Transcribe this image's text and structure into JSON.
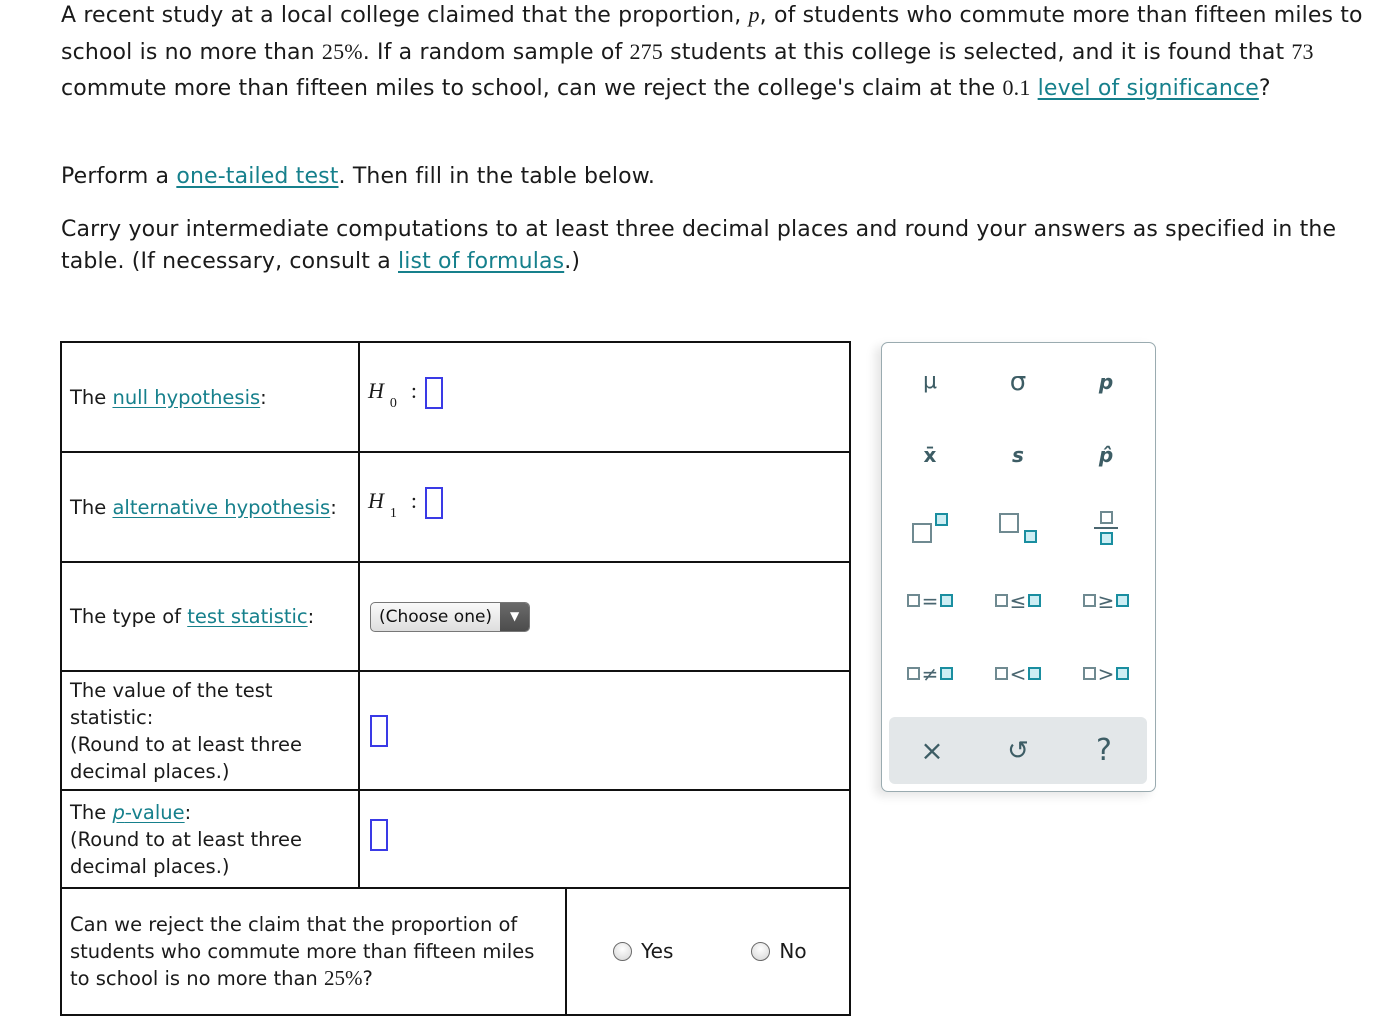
{
  "question": {
    "p1_a": "A recent study at a local college claimed that the proportion, ",
    "p1_var": "p",
    "p1_b": ", of students who commute more than fifteen miles to school is no more than ",
    "p1_pct": "25%",
    "p1_c": ". If a random sample of ",
    "p1_n": "275",
    "p1_d": " students at this college is selected, and it is found that ",
    "p1_x": "73",
    "p1_e": " commute more than fifteen miles to school, can we reject the college's claim at the ",
    "p1_alpha": "0.1",
    "p1_sp": " ",
    "p1_link": "level of significance",
    "p1_f": "?",
    "p2_a": "Perform a ",
    "p2_link": "one-tailed test",
    "p2_b": ". Then fill in the table below.",
    "p3_a": "Carry your intermediate computations to at least three decimal places and round your answers as specified in the table. (If necessary, consult a ",
    "p3_link": "list of formulas",
    "p3_b": ".)"
  },
  "table": {
    "null": {
      "prefix": "The ",
      "link": "null hypothesis",
      "suffix": ":",
      "symbol": "H",
      "sub": "0",
      "colon": ":"
    },
    "alt": {
      "prefix": "The ",
      "link": "alternative hypothesis",
      "suffix": ":",
      "symbol": "H",
      "sub": "1",
      "colon": ":"
    },
    "type": {
      "prefix": "The type of ",
      "link": "test statistic",
      "suffix": ":",
      "select_value": "(Choose one)",
      "arrow": "▼"
    },
    "value": {
      "line1": "The value of the test statistic:",
      "line2": "(Round to at least three decimal places.)"
    },
    "pvalue": {
      "prefix": "The ",
      "link_var": "p",
      "link_rest": "-value",
      "suffix": ":",
      "line2": "(Round to at least three decimal places.)"
    },
    "reject": {
      "text": "Can we reject the claim that the proportion of students who commute more than fifteen miles to school is no more than ",
      "pct": "25%",
      "end": "?",
      "options": [
        "Yes",
        "No"
      ]
    }
  },
  "keypad": {
    "row1": [
      "μ",
      "σ",
      "p"
    ],
    "row2": [
      "x̄",
      "s",
      "p̂"
    ],
    "row3": [
      "superscript",
      "subscript",
      "fraction"
    ],
    "row4": [
      "=",
      "≤",
      "≥"
    ],
    "row5": [
      "≠",
      "<",
      ">"
    ],
    "footer": [
      "×",
      "↺",
      "?"
    ]
  }
}
